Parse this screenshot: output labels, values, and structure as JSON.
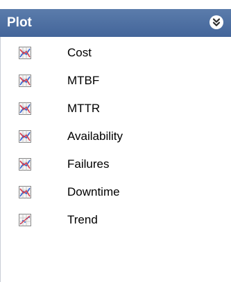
{
  "panel": {
    "title": "Plot",
    "collapse_icon": "double-chevron-down-icon"
  },
  "items": [
    {
      "label": "Cost",
      "icon": "chart-icon"
    },
    {
      "label": "MTBF",
      "icon": "chart-icon"
    },
    {
      "label": "MTTR",
      "icon": "chart-icon"
    },
    {
      "label": "Availability",
      "icon": "chart-icon"
    },
    {
      "label": "Failures",
      "icon": "chart-icon"
    },
    {
      "label": "Downtime",
      "icon": "chart-icon"
    },
    {
      "label": "Trend",
      "icon": "trend-chart-icon"
    }
  ],
  "colors": {
    "header_background": "#4a6ba0",
    "header_text": "#ffffff",
    "body_background": "#ffffff"
  }
}
